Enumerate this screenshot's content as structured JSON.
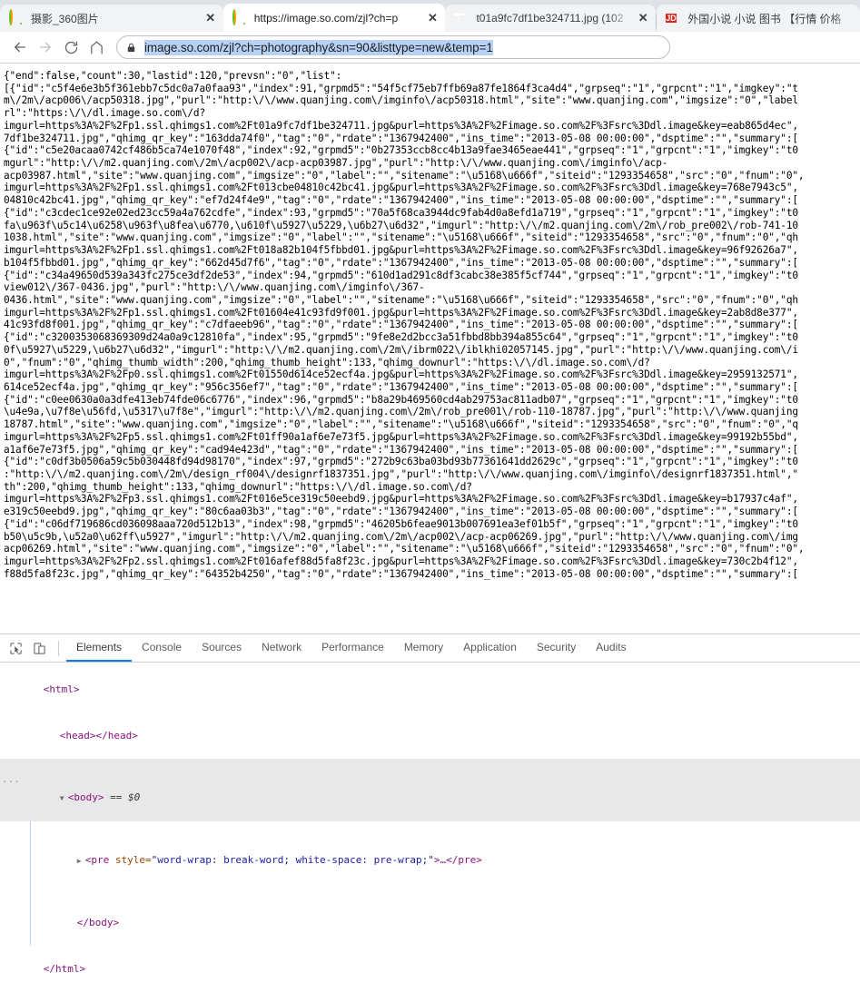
{
  "browser": {
    "tabs": [
      {
        "title": "摄影_360图片",
        "favicon": "so-360-icon",
        "active": false,
        "close_label": "✕"
      },
      {
        "title": "https://image.so.com/zjl?ch=p",
        "favicon": "so-360-icon",
        "active": true,
        "close_label": "✕"
      },
      {
        "title": "t01a9fc7df1be324711.jpg (102",
        "favicon": "globe-icon",
        "active": false,
        "close_label": "✕"
      },
      {
        "title": "外国小说 小说 图书 【行情 价格 ",
        "favicon": "jd-icon",
        "favicon_text": "JD",
        "active": false,
        "close_label": ""
      }
    ],
    "toolbar": {
      "back_label": "←",
      "forward_label": "→",
      "reload_label": "⟳",
      "home_label": "⌂",
      "lock_icon": "lock-icon",
      "url": "image.so.com/zjl?ch=photography&sn=90&listtype=new&temp=1"
    }
  },
  "page": {
    "json_dump": "{\"end\":false,\"count\":30,\"lastid\":120,\"prevsn\":\"0\",\"list\":\n[{\"id\":\"c5f4e6e3b5f361ebb7c5dc0a7a0faa93\",\"index\":91,\"grpmd5\":\"54f5cf75eb7ffb69a87fe1864f3ca4d4\",\"grpseq\":\"1\",\"grpcnt\":\"1\",\"imgkey\":\"t\nm\\/2m\\/acp006\\/acp50318.jpg\",\"purl\":\"http:\\/\\/www.quanjing.com\\/imginfo\\/acp50318.html\",\"site\":\"www.quanjing.com\",\"imgsize\":\"0\",\"label\nrl\":\"https:\\/\\/dl.image.so.com\\/d?\nimgurl=https%3A%2F%2Fp1.ssl.qhimgs1.com%2Ft01a9fc7df1be324711.jpg&purl=https%3A%2F%2Fimage.so.com%2F%3Fsrc%3Ddl.image&key=eab865d4ec\",\n7df1be324711.jpg\",\"qhimg_qr_key\":\"163dda74f0\",\"tag\":\"0\",\"rdate\":\"1367942400\",\"ins_time\":\"2013-05-08 00:00:00\",\"dsptime\":\"\",\"summary\":[\n{\"id\":\"c5e20acaa0742cf486b5ca74e1070f48\",\"index\":92,\"grpmd5\":\"0b27353ccb8cc4b13a9fae3465eae441\",\"grpseq\":\"1\",\"grpcnt\":\"1\",\"imgkey\":\"t0\nmgurl\":\"http:\\/\\/m2.quanjing.com\\/2m\\/acp002\\/acp-acp03987.jpg\",\"purl\":\"http:\\/\\/www.quanjing.com\\/imginfo\\/acp-\nacp03987.html\",\"site\":\"www.quanjing.com\",\"imgsize\":\"0\",\"label\":\"\",\"sitename\":\"\\u5168\\u666f\",\"siteid\":\"1293354658\",\"src\":\"0\",\"fnum\":\"0\",\nimgurl=https%3A%2F%2Fp1.ssl.qhimgs1.com%2Ft013cbe04810c42bc41.jpg&purl=https%3A%2F%2Fimage.so.com%2F%3Fsrc%3Ddl.image&key=768e7943c5\",\n04810c42bc41.jpg\",\"qhimg_qr_key\":\"ef7d24f4e9\",\"tag\":\"0\",\"rdate\":\"1367942400\",\"ins_time\":\"2013-05-08 00:00:00\",\"dsptime\":\"\",\"summary\":[\n{\"id\":\"c3cdec1ce92e02ed23cc59a4a762cdfe\",\"index\":93,\"grpmd5\":\"70a5f68ca3944dc9fab4d0a8efd1a719\",\"grpseq\":\"1\",\"grpcnt\":\"1\",\"imgkey\":\"t0\nfa\\u963f\\u5c14\\u6258\\u963f\\u8fea\\u6770,\\u610f\\u5927\\u5229,\\u6b27\\u6d32\",\"imgurl\":\"http:\\/\\/m2.quanjing.com\\/2m\\/rob_pre002\\/rob-741-10\n1038.html\",\"site\":\"www.quanjing.com\",\"imgsize\":\"0\",\"label\":\"\",\"sitename\":\"\\u5168\\u666f\",\"siteid\":\"1293354658\",\"src\":\"0\",\"fnum\":\"0\",\"qh\nimgurl=https%3A%2F%2Fp1.ssl.qhimgs1.com%2Ft018a82b104f5fbbd01.jpg&purl=https%3A%2F%2Fimage.so.com%2F%3Fsrc%3Ddl.image&key=96f92626a7\",\nb104f5fbbd01.jpg\",\"qhimg_qr_key\":\"662d45d7f6\",\"tag\":\"0\",\"rdate\":\"1367942400\",\"ins_time\":\"2013-05-08 00:00:00\",\"dsptime\":\"\",\"summary\":[\n{\"id\":\"c34a49650d539a343fc275ce3df2de53\",\"index\":94,\"grpmd5\":\"610d1ad291c8df3cabc38e385f5cf744\",\"grpseq\":\"1\",\"grpcnt\":\"1\",\"imgkey\":\"t0\nview012\\/367-0436.jpg\",\"purl\":\"http:\\/\\/www.quanjing.com\\/imginfo\\/367-\n0436.html\",\"site\":\"www.quanjing.com\",\"imgsize\":\"0\",\"label\":\"\",\"sitename\":\"\\u5168\\u666f\",\"siteid\":\"1293354658\",\"src\":\"0\",\"fnum\":\"0\",\"qh\nimgurl=https%3A%2F%2Fp1.ssl.qhimgs1.com%2Ft01604e41c93fd9f001.jpg&purl=https%3A%2F%2Fimage.so.com%2F%3Fsrc%3Ddl.image&key=2ab8d8e377\",\n41c93fd8f001.jpg\",\"qhimg_qr_key\":\"c7dfaeeb96\",\"tag\":\"0\",\"rdate\":\"1367942400\",\"ins_time\":\"2013-05-08 00:00:00\",\"dsptime\":\"\",\"summary\":[\n{\"id\":\"c3200353068369309d24a0a9c12810fa\",\"index\":95,\"grpmd5\":\"9fe8e2d2bcc3a51fbbd8bb394a855c64\",\"grpseq\":\"1\",\"grpcnt\":\"1\",\"imgkey\":\"t0\n0f\\u5927\\u5229,\\u6b27\\u6d32\",\"imgurl\":\"http:\\/\\/m2.quanjing.com\\/2m\\/ibrm022\\/iblkhi02057145.jpg\",\"purl\":\"http:\\/\\/www.quanjing.com\\/i\n0\",\"fnum\":\"0\",\"qhimg_thumb_width\":200,\"qhimg_thumb_height\":133,\"qhimg_downurl\":\"https:\\/\\/dl.image.so.com\\/d?\nimgurl=https%3A%2F%2Fp0.ssl.qhimgs1.com%2Ft01550d614ce52ecf4a.jpg&purl=https%3A%2F%2Fimage.so.com%2F%3Fsrc%3Ddl.image&key=2959132571\",\n614ce52ecf4a.jpg\",\"qhimg_qr_key\":\"956c356ef7\",\"tag\":\"0\",\"rdate\":\"1367942400\",\"ins_time\":\"2013-05-08 00:00:00\",\"dsptime\":\"\",\"summary\":[\n{\"id\":\"c0ee0630a0a3dfe413eb74fde06c6776\",\"index\":96,\"grpmd5\":\"b8a29b469560cd4ab29753ac811adb07\",\"grpseq\":\"1\",\"grpcnt\":\"1\",\"imgkey\":\"t0\n\\u4e9a,\\u7f8e\\u56fd,\\u5317\\u7f8e\",\"imgurl\":\"http:\\/\\/m2.quanjing.com\\/2m\\/rob_pre001\\/rob-110-18787.jpg\",\"purl\":\"http:\\/\\/www.quanjing\n18787.html\",\"site\":\"www.quanjing.com\",\"imgsize\":\"0\",\"label\":\"\",\"sitename\":\"\\u5168\\u666f\",\"siteid\":\"1293354658\",\"src\":\"0\",\"fnum\":\"0\",\"q\nimgurl=https%3A%2F%2Fp5.ssl.qhimgs1.com%2Ft01ff90a1af6e7e73f5.jpg&purl=https%3A%2F%2Fimage.so.com%2F%3Fsrc%3Ddl.image&key=99192b55bd\",\na1af6e7e73f5.jpg\",\"qhimg_qr_key\":\"cad94e423d\",\"tag\":\"0\",\"rdate\":\"1367942400\",\"ins_time\":\"2013-05-08 00:00:00\",\"dsptime\":\"\",\"summary\":[\n{\"id\":\"c0df3b0506a59c5b030448fd94d98170\",\"index\":97,\"grpmd5\":\"272b9c63ba03bd93b77361641dd2629c\",\"grpseq\":\"1\",\"grpcnt\":\"1\",\"imgkey\":\"t0\n:\"http:\\/\\/m2.quanjing.com\\/2m\\/design_rf004\\/designrf1837351.jpg\",\"purl\":\"http:\\/\\/www.quanjing.com\\/imginfo\\/designrf1837351.html\",\"\nth\":200,\"qhimg_thumb_height\":133,\"qhimg_downurl\":\"https:\\/\\/dl.image.so.com\\/d?\nimgurl=https%3A%2F%2Fp3.ssl.qhimgs1.com%2Ft016e5ce319c50eebd9.jpg&purl=https%3A%2F%2Fimage.so.com%2F%3Fsrc%3Ddl.image&key=b17937c4af\",\ne319c50eebd9.jpg\",\"qhimg_qr_key\":\"80c6aa03b3\",\"tag\":\"0\",\"rdate\":\"1367942400\",\"ins_time\":\"2013-05-08 00:00:00\",\"dsptime\":\"\",\"summary\":[\n{\"id\":\"c06df719686cd036098aaa720d512b13\",\"index\":98,\"grpmd5\":\"46205b6feae9013b007691ea3ef01b5f\",\"grpseq\":\"1\",\"grpcnt\":\"1\",\"imgkey\":\"t0\nb50\\u5c9b,\\u52a0\\u62ff\\u5927\",\"imgurl\":\"http:\\/\\/m2.quanjing.com\\/2m\\/acp002\\/acp-acp06269.jpg\",\"purl\":\"http:\\/\\/www.quanjing.com\\/img\nacp06269.html\",\"site\":\"www.quanjing.com\",\"imgsize\":\"0\",\"label\":\"\",\"sitename\":\"\\u5168\\u666f\",\"siteid\":\"1293354658\",\"src\":\"0\",\"fnum\":\"0\",\nimgurl=https%3A%2F%2Fp2.ssl.qhimgs1.com%2Ft016afef88d5fa8f23c.jpg&purl=https%3A%2F%2Fimage.so.com%2F%3Fsrc%3Ddl.image&key=730c2b4f12\",\nf88d5fa8f23c.jpg\",\"qhimg_qr_key\":\"64352b4250\",\"tag\":\"0\",\"rdate\":\"1367942400\",\"ins_time\":\"2013-05-08 00:00:00\",\"dsptime\":\"\",\"summary\":["
  },
  "devtools": {
    "inspect_icon": "inspect-element-icon",
    "device_icon": "device-toolbar-icon",
    "tabs": [
      {
        "label": "Elements",
        "active": true
      },
      {
        "label": "Console",
        "active": false
      },
      {
        "label": "Sources",
        "active": false
      },
      {
        "label": "Network",
        "active": false
      },
      {
        "label": "Performance",
        "active": false
      },
      {
        "label": "Memory",
        "active": false
      },
      {
        "label": "Application",
        "active": false
      },
      {
        "label": "Security",
        "active": false
      },
      {
        "label": "Audits",
        "active": false
      }
    ],
    "dom": {
      "line1": "<html>",
      "line2": "<head></head>",
      "line3_tag": "<body>",
      "line3_marker": "== $0",
      "line4_open": "<pre",
      "line4_attr_name": "style=",
      "line4_attr_value": "\"word-wrap: break-word; white-space: pre-wrap;\"",
      "line4_close": ">…</pre>",
      "line5": "</body>",
      "line6": "</html>"
    }
  },
  "colors": {
    "chrome_tabbar": "#dee1e6",
    "tab_active": "#ffffff",
    "url_selection": "#b7d1f5",
    "devtools_accent": "#1a73e8",
    "jd_red": "#e1251b",
    "so_orange": "#ff9900",
    "so_green": "#5ac51a"
  }
}
